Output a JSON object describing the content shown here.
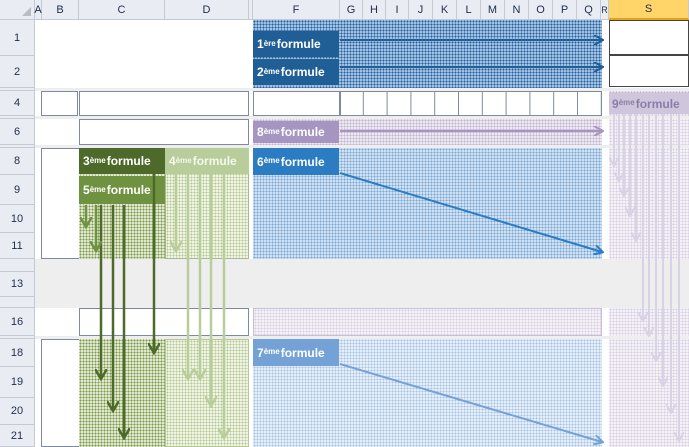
{
  "columns": [
    "A",
    "B",
    "C",
    "D",
    "E",
    "F",
    "G",
    "H",
    "I",
    "J",
    "K",
    "L",
    "M",
    "N",
    "O",
    "P",
    "Q",
    "R",
    "S"
  ],
  "rows": [
    "1",
    "2",
    "4",
    "6",
    "8",
    "9",
    "10",
    "11",
    "13",
    "16",
    "18",
    "19",
    "20",
    "21"
  ],
  "labels": {
    "f1": {
      "sup": "ère",
      "text": " formule",
      "num": "1"
    },
    "f2": {
      "sup": "ème",
      "text": " formule",
      "num": "2"
    },
    "f3": {
      "sup": "ème",
      "text": " formule",
      "num": "3"
    },
    "f4": {
      "sup": "ème",
      "text": " formule",
      "num": "4"
    },
    "f5": {
      "sup": "ème",
      "text": " formule",
      "num": "5"
    },
    "f6": {
      "sup": "ème",
      "text": " formule",
      "num": "6"
    },
    "f7": {
      "sup": "ème",
      "text": " formule",
      "num": "7"
    },
    "f8": {
      "sup": "ème",
      "text": " formule",
      "num": "8"
    },
    "f9": {
      "sup": "ème",
      "text": " formule",
      "num": "9"
    }
  },
  "selected_column": "S",
  "colors": {
    "dark_blue": "#1f5f95",
    "blue": "#2b7cc2",
    "light_blue": "#74a2d6",
    "dark_green": "#4d6a2a",
    "mid_green": "#6f9240",
    "light_green": "#b9cd9b",
    "lavender": "#a595c0",
    "pale_lavender": "#d9d1e4"
  }
}
